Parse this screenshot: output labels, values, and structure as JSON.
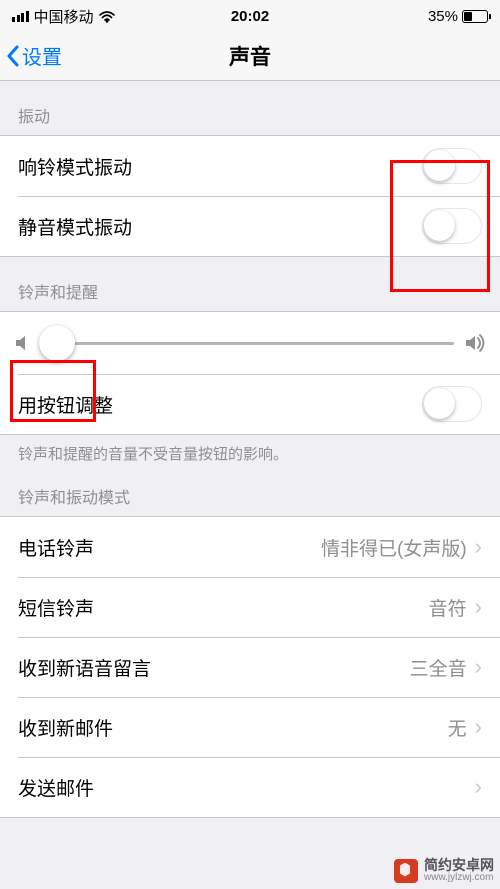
{
  "status": {
    "carrier": "中国移动",
    "time": "20:02",
    "battery_pct": "35%"
  },
  "nav": {
    "back_label": "设置",
    "title": "声音"
  },
  "vibrate": {
    "section": "振动",
    "ring_label": "响铃模式振动",
    "silent_label": "静音模式振动"
  },
  "ringer": {
    "section": "铃声和提醒",
    "button_adjust_label": "用按钮调整",
    "footer": "铃声和提醒的音量不受音量按钮的影响。"
  },
  "sounds": {
    "section": "铃声和振动模式",
    "ringtone_label": "电话铃声",
    "ringtone_value": "情非得已(女声版)",
    "text_label": "短信铃声",
    "text_value": "音符",
    "voicemail_label": "收到新语音留言",
    "voicemail_value": "三全音",
    "newmail_label": "收到新邮件",
    "newmail_value": "无",
    "sentmail_label": "发送邮件",
    "sentmail_value": ""
  },
  "watermark": {
    "title": "简约安卓网",
    "url": "www.jylzwj.com"
  }
}
